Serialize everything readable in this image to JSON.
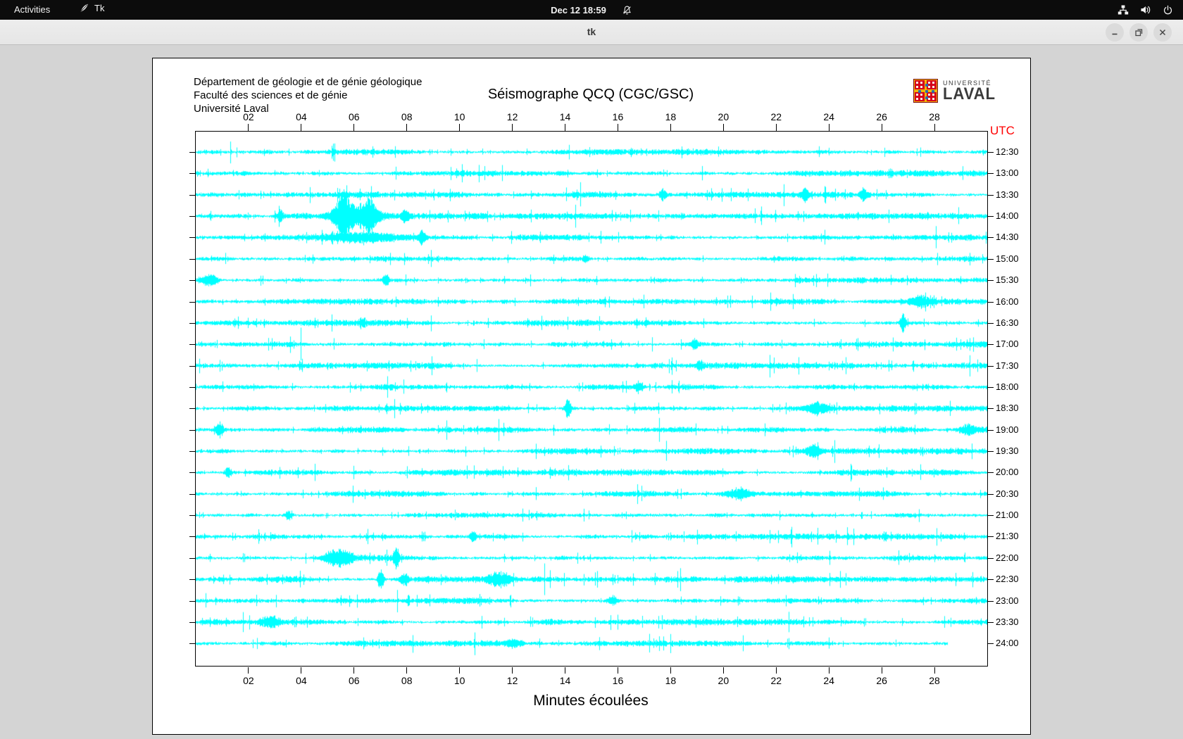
{
  "top_bar": {
    "activities_label": "Activities",
    "app_name": "Tk",
    "clock": "Dec 12  18:59",
    "icons": [
      "tk-feather-icon",
      "notifications-muted-icon",
      "network-wired-icon",
      "volume-icon",
      "power-icon"
    ]
  },
  "window": {
    "title": "tk",
    "controls": [
      "minimize",
      "maximize",
      "close"
    ]
  },
  "header": {
    "dept_lines": [
      "Département de géologie et de génie géologique",
      "Faculté des sciences et de génie",
      "Université Laval"
    ],
    "title": "Séismographe QCQ (CGC/GSC)"
  },
  "logo": {
    "line1": "UNIVERSITÉ",
    "line2": "LAVAL",
    "shield_red": "#d6001c",
    "shield_gold": "#f2b705",
    "shield_blue": "#2a6db0"
  },
  "chart_data": {
    "type": "line",
    "subtype": "seismogram-helicorder",
    "station": "QCQ (CGC/GSC)",
    "title": "Séismographe QCQ (CGC/GSC)",
    "xlabel": "Minutes écoulées",
    "right_axis_title": "UTC",
    "x_range": [
      0,
      30
    ],
    "x_tick_labels": [
      "02",
      "04",
      "06",
      "08",
      "10",
      "12",
      "14",
      "16",
      "18",
      "20",
      "22",
      "24",
      "26",
      "28"
    ],
    "row_labels": [
      "12:30",
      "13:00",
      "13:30",
      "14:00",
      "14:30",
      "15:00",
      "15:30",
      "16:00",
      "16:30",
      "17:00",
      "17:30",
      "18:00",
      "18:30",
      "19:00",
      "19:30",
      "20:00",
      "20:30",
      "21:00",
      "21:30",
      "22:00",
      "22:30",
      "23:00",
      "23:30",
      "24:00"
    ],
    "minutes_per_row": 30,
    "trace_color": "#00ffff",
    "axis_color": "#000000",
    "utc_color": "#ff0000",
    "background": "#ffffff",
    "grid": false,
    "noise_base_amp": 1.6,
    "seed": 911,
    "last_row_end_minute": 28.5,
    "events": [
      {
        "row": 2,
        "minute": 17.7,
        "amp": 5,
        "width": 0.12
      },
      {
        "row": 2,
        "minute": 23.1,
        "amp": 6,
        "width": 0.12
      },
      {
        "row": 2,
        "minute": 25.3,
        "amp": 7,
        "width": 0.12
      },
      {
        "row": 3,
        "minute": 3.2,
        "amp": 6,
        "width": 0.12
      },
      {
        "row": 3,
        "minute": 5.6,
        "amp": 20,
        "width": 0.3
      },
      {
        "row": 3,
        "minute": 6.6,
        "amp": 15,
        "width": 0.3
      },
      {
        "row": 3,
        "minute": 6.0,
        "amp": 7,
        "width": 0.9
      },
      {
        "row": 3,
        "minute": 7.9,
        "amp": 6,
        "width": 0.15
      },
      {
        "row": 4,
        "minute": 6.5,
        "amp": 4,
        "width": 1.8
      },
      {
        "row": 4,
        "minute": 8.6,
        "amp": 7,
        "width": 0.12
      },
      {
        "row": 5,
        "minute": 14.8,
        "amp": 4,
        "width": 0.12
      },
      {
        "row": 6,
        "minute": 0.5,
        "amp": 5,
        "width": 0.3
      },
      {
        "row": 6,
        "minute": 7.2,
        "amp": 6,
        "width": 0.12
      },
      {
        "row": 7,
        "minute": 27.5,
        "amp": 5,
        "width": 0.5
      },
      {
        "row": 8,
        "minute": 6.3,
        "amp": 5,
        "width": 0.12
      },
      {
        "row": 8,
        "minute": 26.8,
        "amp": 9,
        "width": 0.12
      },
      {
        "row": 9,
        "minute": 18.9,
        "amp": 5,
        "width": 0.12
      },
      {
        "row": 10,
        "minute": 19.1,
        "amp": 5,
        "width": 0.12
      },
      {
        "row": 11,
        "minute": 16.8,
        "amp": 5,
        "width": 0.15
      },
      {
        "row": 12,
        "minute": 14.1,
        "amp": 10,
        "width": 0.12
      },
      {
        "row": 12,
        "minute": 23.5,
        "amp": 5,
        "width": 0.4
      },
      {
        "row": 13,
        "minute": 0.9,
        "amp": 7,
        "width": 0.15
      },
      {
        "row": 13,
        "minute": 29.3,
        "amp": 5,
        "width": 0.3
      },
      {
        "row": 14,
        "minute": 23.4,
        "amp": 6,
        "width": 0.3
      },
      {
        "row": 15,
        "minute": 1.2,
        "amp": 5,
        "width": 0.12
      },
      {
        "row": 16,
        "minute": 20.6,
        "amp": 5,
        "width": 0.5
      },
      {
        "row": 17,
        "minute": 3.5,
        "amp": 5,
        "width": 0.12
      },
      {
        "row": 18,
        "minute": 10.5,
        "amp": 5,
        "width": 0.12
      },
      {
        "row": 19,
        "minute": 5.4,
        "amp": 8,
        "width": 0.5
      },
      {
        "row": 19,
        "minute": 7.6,
        "amp": 10,
        "width": 0.1
      },
      {
        "row": 20,
        "minute": 7.0,
        "amp": 12,
        "width": 0.1
      },
      {
        "row": 20,
        "minute": 7.9,
        "amp": 6,
        "width": 0.15
      },
      {
        "row": 20,
        "minute": 11.5,
        "amp": 6,
        "width": 0.4
      },
      {
        "row": 21,
        "minute": 15.8,
        "amp": 5,
        "width": 0.2
      },
      {
        "row": 22,
        "minute": 2.8,
        "amp": 5,
        "width": 0.3
      },
      {
        "row": 23,
        "minute": 12.0,
        "amp": 4,
        "width": 0.3
      }
    ]
  }
}
